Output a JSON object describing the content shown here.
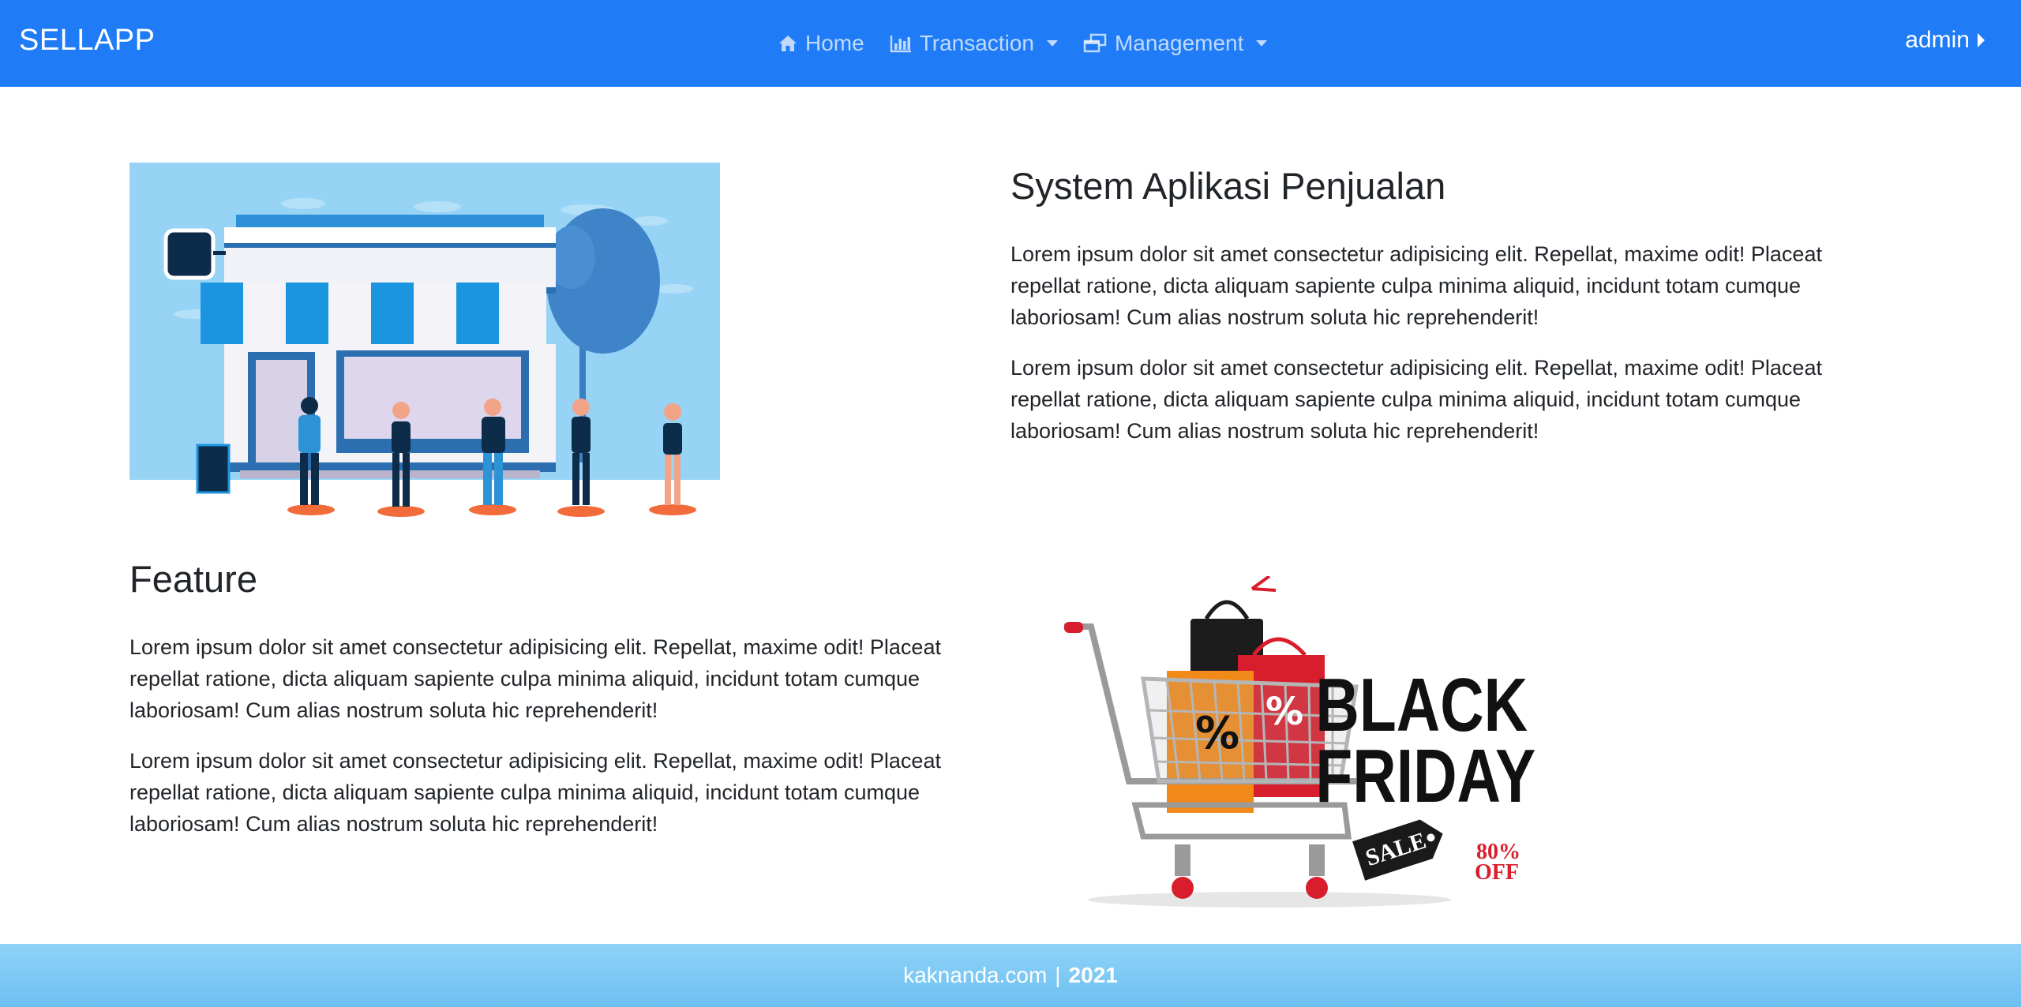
{
  "navbar": {
    "brand": "SELLAPP",
    "items": [
      {
        "label": "Home",
        "icon": "home-icon"
      },
      {
        "label": "Transaction",
        "icon": "bar-chart-icon"
      },
      {
        "label": "Management",
        "icon": "windows-icon"
      }
    ],
    "user": "admin"
  },
  "hero": {
    "title": "System Aplikasi Penjualan",
    "paragraphs": [
      "Lorem ipsum dolor sit amet consectetur adipisicing elit. Repellat, maxime odit! Placeat repellat ratione, dicta aliquam sapiente culpa minima aliquid, incidunt totam cumque laboriosam! Cum alias nostrum soluta hic reprehenderit!",
      "Lorem ipsum dolor sit amet consectetur adipisicing elit. Repellat, maxime odit! Placeat repellat ratione, dicta aliquam sapiente culpa minima aliquid, incidunt totam cumque laboriosam! Cum alias nostrum soluta hic reprehenderit!"
    ]
  },
  "feature": {
    "title": "Feature",
    "paragraphs": [
      "Lorem ipsum dolor sit amet consectetur adipisicing elit. Repellat, maxime odit! Placeat repellat ratione, dicta aliquam sapiente culpa minima aliquid, incidunt totam cumque laboriosam! Cum alias nostrum soluta hic reprehenderit!",
      "Lorem ipsum dolor sit amet consectetur adipisicing elit. Repellat, maxime odit! Placeat repellat ratione, dicta aliquam sapiente culpa minima aliquid, incidunt totam cumque laboriosam! Cum alias nostrum soluta hic reprehenderit!"
    ]
  },
  "promo": {
    "line1": "BLACK",
    "line2": "FRIDAY",
    "tag": "SALE",
    "discount_line1": "80%",
    "discount_line2": "OFF"
  },
  "footer": {
    "site": "kaknanda.com",
    "separator": "|",
    "year": "2021"
  },
  "colors": {
    "navbar": "#1f7bf6",
    "footer": "#8ed3f8",
    "text": "#212529"
  }
}
